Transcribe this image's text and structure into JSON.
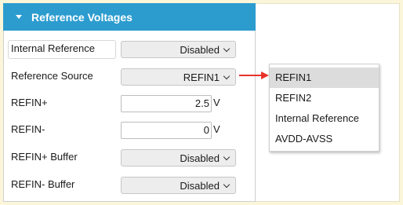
{
  "panel": {
    "title": "Reference Voltages",
    "accent": "#2c9ccf",
    "rows": [
      {
        "label": "Internal Reference",
        "type": "select",
        "value": "Disabled"
      },
      {
        "label": "Reference Source",
        "type": "select",
        "value": "REFIN1"
      },
      {
        "label": "REFIN+",
        "type": "input",
        "value": "2.5",
        "unit": "V"
      },
      {
        "label": "REFIN-",
        "type": "input",
        "value": "0",
        "unit": "V"
      },
      {
        "label": "REFIN+ Buffer",
        "type": "select",
        "value": "Disabled"
      },
      {
        "label": "REFIN- Buffer",
        "type": "select",
        "value": "Disabled"
      }
    ]
  },
  "dropdown": {
    "options": [
      "REFIN1",
      "REFIN2",
      "Internal Reference",
      "AVDD-AVSS"
    ],
    "selected": "REFIN1"
  },
  "arrow_color": "#e8312b",
  "icons": {
    "collapse": "caret-down-icon",
    "select": "chevron-down-icon",
    "pointer": "arrow-right-icon"
  }
}
